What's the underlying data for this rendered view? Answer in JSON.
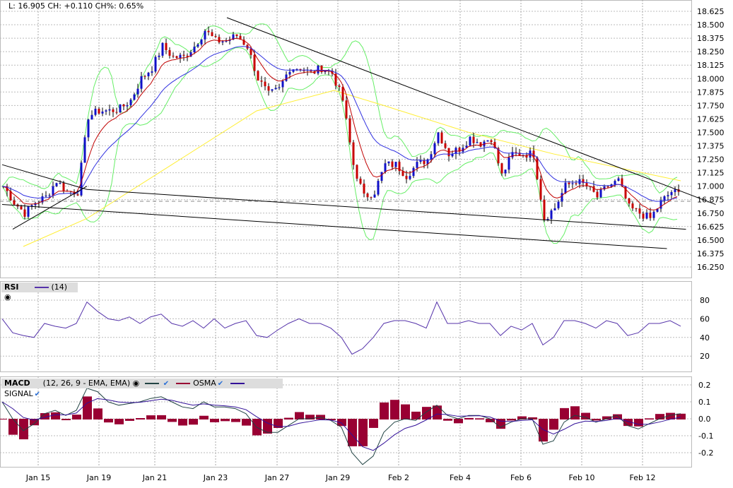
{
  "header": {
    "text": "L: 16.905 CH: +0.110 CH%: 0.65%"
  },
  "rsi_legend": {
    "name": "RSI",
    "params": "(14)"
  },
  "macd_legend": {
    "name": "MACD",
    "params": "(12, 26, 9 - EMA, EMA)",
    "osma": "OSMA",
    "signal": "SIGNAL"
  },
  "colors": {
    "up": "#1010c8",
    "down": "#c80000",
    "ema_fast": "#c00000",
    "ema_slow": "#3030e0",
    "band": "#66ee66",
    "ma200": "#ffee33",
    "rsi": "#5533aa",
    "macd": "#224444",
    "signal": "#331199",
    "osma": "#990033"
  },
  "chart_data": [
    {
      "type": "candlestick",
      "title": "Price",
      "x_ticks": [
        "Jan 15",
        "Jan 19",
        "Jan 21",
        "Jan 23",
        "Jan 27",
        "Jan 29",
        "Feb 2",
        "Feb 4",
        "Feb 6",
        "Feb 10",
        "Feb 12"
      ],
      "y_ticks": [
        "18.625",
        "18.500",
        "18.375",
        "18.250",
        "18.125",
        "18.000",
        "17.875",
        "17.750",
        "17.625",
        "17.500",
        "17.375",
        "17.250",
        "17.125",
        "17.000",
        "16.875",
        "16.750",
        "16.625",
        "16.500",
        "16.375",
        "16.250"
      ],
      "ylim": [
        16.188,
        18.688
      ],
      "close": [
        17.0,
        16.85,
        16.75,
        16.85,
        16.9,
        17.05,
        16.95,
        16.95,
        17.65,
        17.7,
        17.7,
        17.72,
        17.8,
        18.0,
        18.1,
        18.3,
        18.2,
        18.2,
        18.3,
        18.45,
        18.35,
        18.35,
        18.4,
        18.3,
        18.0,
        17.85,
        17.9,
        18.1,
        18.1,
        18.05,
        18.1,
        18.05,
        17.8,
        17.2,
        16.9,
        16.95,
        17.2,
        17.2,
        17.1,
        17.2,
        17.25,
        17.5,
        17.3,
        17.35,
        17.45,
        17.4,
        17.45,
        17.1,
        17.3,
        17.3,
        17.3,
        16.7,
        16.8,
        17.0,
        17.05,
        17.0,
        16.9,
        17.0,
        17.05,
        16.8,
        16.75,
        16.7,
        16.85,
        16.95,
        16.92
      ],
      "ma200": [
        [
          2,
          16.44
        ],
        [
          8,
          16.7
        ],
        [
          16,
          17.2
        ],
        [
          24,
          17.7
        ],
        [
          31.3,
          17.89
        ],
        [
          36,
          17.75
        ],
        [
          44,
          17.5
        ],
        [
          52,
          17.3
        ],
        [
          64,
          17.05
        ]
      ],
      "trendlines": [
        [
          [
            21.2,
            18.566
          ],
          [
            67.3,
            16.83
          ]
        ],
        [
          [
            0,
            17.2
          ],
          [
            8,
            16.97
          ]
        ],
        [
          [
            1,
            16.6
          ],
          [
            8,
            17.0
          ]
        ],
        [
          [
            0,
            16.83
          ],
          [
            62.7,
            16.42
          ]
        ],
        [
          [
            8,
            16.97
          ],
          [
            64.5,
            16.6
          ]
        ]
      ],
      "last_level": 16.86
    },
    {
      "type": "line",
      "title": "RSI",
      "y_ticks": [
        "80",
        "60",
        "40",
        "20"
      ],
      "values": [
        60,
        45,
        42,
        40,
        55,
        52,
        50,
        55,
        78,
        68,
        60,
        58,
        62,
        55,
        62,
        65,
        55,
        52,
        58,
        50,
        60,
        50,
        55,
        58,
        42,
        40,
        48,
        55,
        60,
        55,
        55,
        50,
        40,
        22,
        28,
        40,
        55,
        58,
        58,
        55,
        50,
        78,
        55,
        55,
        58,
        55,
        55,
        42,
        52,
        48,
        55,
        32,
        40,
        58,
        58,
        55,
        50,
        58,
        55,
        42,
        45,
        55,
        55,
        58,
        52
      ]
    },
    {
      "type": "line",
      "title": "MACD",
      "y_ticks": [
        "0.2",
        "0.1",
        "0.0",
        "-0.1",
        "-0.2"
      ],
      "values": [
        0.1,
        0.0,
        -0.07,
        -0.03,
        0.03,
        0.05,
        0.02,
        0.05,
        0.18,
        0.16,
        0.1,
        0.08,
        0.09,
        0.1,
        0.12,
        0.13,
        0.1,
        0.07,
        0.06,
        0.1,
        0.07,
        0.07,
        0.06,
        0.03,
        -0.05,
        -0.08,
        -0.08,
        -0.04,
        0.0,
        0.0,
        0.01,
        -0.01,
        -0.05,
        -0.2,
        -0.27,
        -0.22,
        -0.08,
        -0.02,
        0.0,
        -0.01,
        0.04,
        0.08,
        0.02,
        0.0,
        0.02,
        0.02,
        0.0,
        -0.05,
        -0.02,
        0.0,
        0.0,
        -0.15,
        -0.13,
        -0.02,
        0.02,
        0.01,
        -0.02,
        0.0,
        0.02,
        -0.04,
        -0.06,
        -0.03,
        0.0,
        0.02,
        0.03
      ]
    }
  ]
}
